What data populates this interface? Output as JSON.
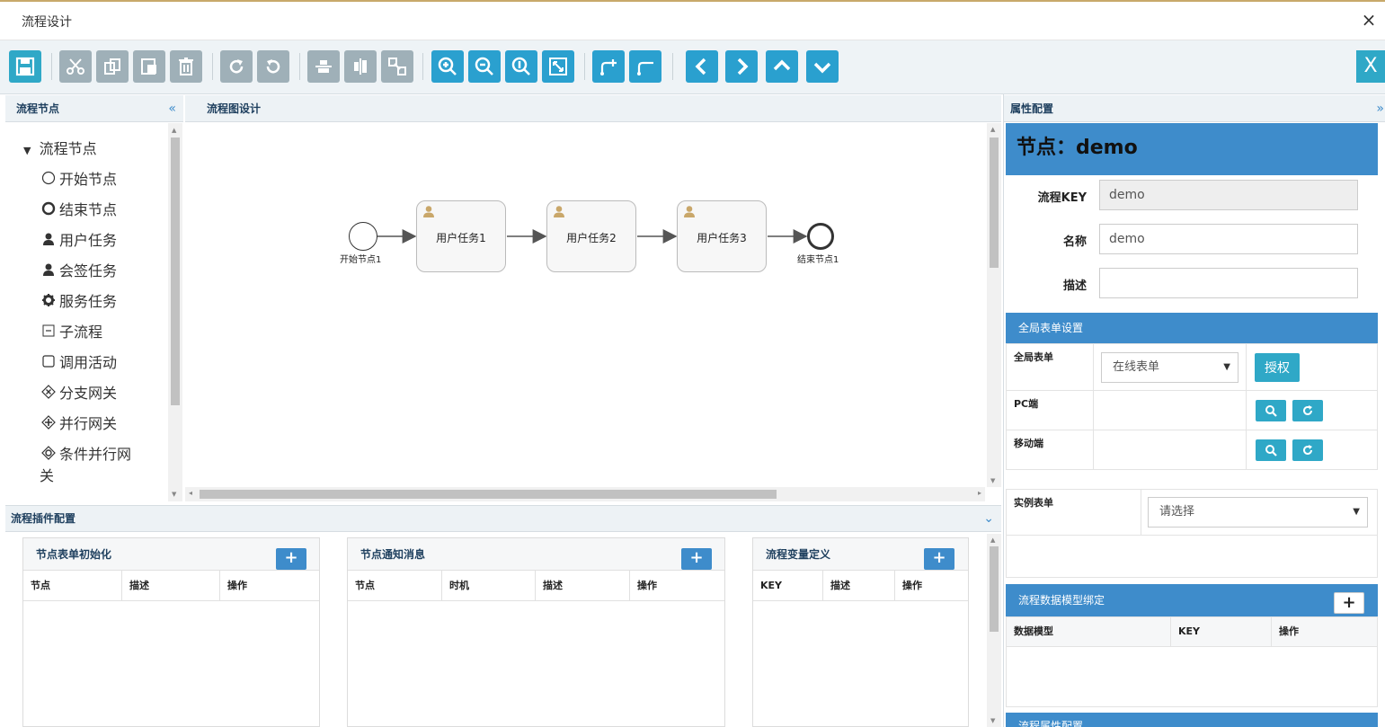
{
  "window": {
    "title": "流程设计",
    "close_glyph": "×"
  },
  "toolbar": {
    "buttons": [
      "save-icon",
      "cut-icon",
      "copy-icon",
      "paste-icon",
      "delete-icon",
      "redo-icon",
      "undo-icon",
      "align-horizontal-icon",
      "align-vertical-icon",
      "resize-icon",
      "zoom-in-icon",
      "zoom-out-icon",
      "zoom-reset-icon",
      "fit-icon",
      "add-flow-icon",
      "remove-flow-icon",
      "arrow-left-icon",
      "arrow-right-icon",
      "arrow-up-icon",
      "arrow-down-icon"
    ],
    "close_label": "X"
  },
  "left_panel": {
    "title": "流程节点",
    "collapse_glyph": "«",
    "root": "流程节点",
    "items": [
      {
        "label": "开始节点",
        "icon": "circle-outline-icon"
      },
      {
        "label": "结束节点",
        "icon": "circle-bold-icon"
      },
      {
        "label": "用户任务",
        "icon": "user-icon"
      },
      {
        "label": "会签任务",
        "icon": "user-icon"
      },
      {
        "label": "服务任务",
        "icon": "gear-icon"
      },
      {
        "label": "子流程",
        "icon": "collapse-box-icon"
      },
      {
        "label": "调用活动",
        "icon": "square-icon"
      },
      {
        "label": "分支网关",
        "icon": "exclusive-gateway-icon"
      },
      {
        "label": "并行网关",
        "icon": "parallel-gateway-icon"
      },
      {
        "label": "条件并行网",
        "icon": "inclusive-gateway-icon"
      }
    ],
    "wrap_line": "关"
  },
  "center_panel": {
    "title": "流程图设计",
    "diagram": {
      "start_label": "开始节点1",
      "tasks": [
        "用户任务1",
        "用户任务2",
        "用户任务3"
      ],
      "end_label": "结束节点1"
    }
  },
  "right_panel": {
    "title": "属性配置",
    "expand_glyph": "»",
    "node_header": "节点：demo",
    "fields": {
      "key_label": "流程KEY",
      "key_value": "demo",
      "name_label": "名称",
      "name_value": "demo",
      "desc_label": "描述",
      "desc_value": ""
    },
    "global_form": {
      "title": "全局表单设置",
      "form_label": "全局表单",
      "form_select": "在线表单",
      "authorize_button": "授权",
      "pc_label": "PC端",
      "mobile_label": "移动端"
    },
    "instance_form": {
      "label": "实例表单",
      "select": "请选择"
    },
    "data_model": {
      "title": "流程数据模型绑定",
      "plus": "+",
      "columns": [
        "数据模型",
        "KEY",
        "操作"
      ]
    },
    "footer_partial": "流程属性配置"
  },
  "bottom_panel": {
    "title": "流程插件配置",
    "expand_glyph": "⌄",
    "panels": [
      {
        "title": "节点表单初始化",
        "plus": "+",
        "columns": [
          "节点",
          "描述",
          "操作"
        ]
      },
      {
        "title": "节点通知消息",
        "plus": "+",
        "columns": [
          "节点",
          "时机",
          "描述",
          "操作"
        ]
      },
      {
        "title": "流程变量定义",
        "plus": "+",
        "columns": [
          "KEY",
          "描述",
          "操作"
        ]
      }
    ]
  },
  "colors": {
    "accent": "#2fa8c7",
    "header_blue": "#3e8ccb",
    "panel_bg": "#edf2f5"
  }
}
